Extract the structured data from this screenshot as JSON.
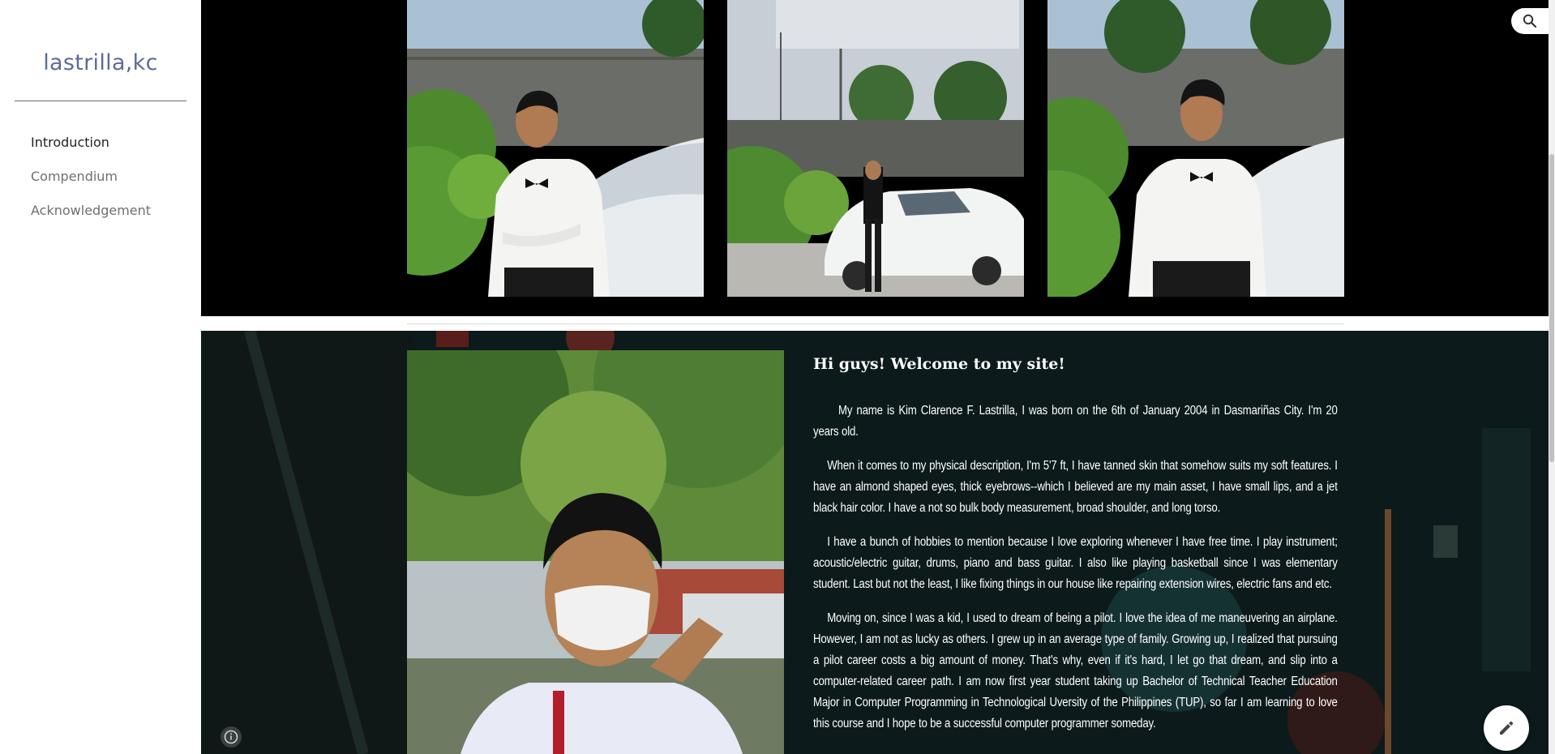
{
  "sidebar": {
    "site_title": "lastrilla,kc",
    "nav": [
      {
        "label": "Introduction",
        "active": true
      },
      {
        "label": "Compendium",
        "active": false
      },
      {
        "label": "Acknowledgement",
        "active": false
      }
    ]
  },
  "intro": {
    "heading": "Hi guys! Welcome to my site!",
    "paragraphs": [
      "My name is Kim Clarence F. Lastrilla, I was born on the 6th of January 2004 in Dasmariñas City. I'm 20 years old.",
      "When it comes to my physical description, I'm 5'7 ft, I have tanned skin that somehow suits my soft features. I have an almond shaped eyes, thick eyebrows--which I believed are my main asset, I have small lips, and a jet black hair color. I have a not so bulk body measurement, broad shoulder, and long torso.",
      "I have a bunch of hobbies to mention because I love exploring whenever I have free time. I play instrument; acoustic/electric guitar, drums, piano and bass guitar. I also like  playing basketball since I was elementary student. Last but not the least, I like fixing things  in our house like repairing extension wires, electric fans and etc.",
      "Moving on, since I was a kid, I used to dream of being a pilot. I love the idea of me maneuvering an airplane. However, I am not as lucky as others. I grew up in an average type of family. Growing up, I realized that pursuing a pilot career costs a big amount of money. That's why, even if it's hard, I let go that dream, and slip into a computer-related career path. I am now first year student taking up Bachelor of Technical Teacher Education Major in Computer Programming in Technological Uversity of the Philippines (TUP), so far I am learning to love this course and I hope to be a successful computer programmer someday."
    ]
  },
  "icons": {
    "search": "search-icon",
    "info": "info-icon",
    "edit": "pencil-icon"
  }
}
